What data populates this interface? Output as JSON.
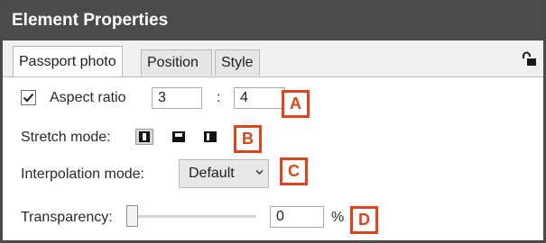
{
  "panel": {
    "title": "Element Properties"
  },
  "tabs": [
    {
      "label": "Passport photo",
      "active": true
    },
    {
      "label": "Position",
      "active": false
    },
    {
      "label": "Style",
      "active": false
    }
  ],
  "aspect_ratio": {
    "label": "Aspect ratio",
    "checked": true,
    "width_value": "3",
    "separator": ":",
    "height_value": "4"
  },
  "stretch_mode": {
    "label": "Stretch mode:",
    "selected_index": 0
  },
  "interpolation_mode": {
    "label": "Interpolation mode:",
    "selected": "Default"
  },
  "transparency": {
    "label": "Transparency:",
    "value": "0",
    "unit": "%",
    "slider_level": 0
  },
  "annotations": {
    "a": "A",
    "b": "B",
    "c": "C",
    "d": "D"
  },
  "colors": {
    "titlebar": "#4b4b4b",
    "annotation": "#e0421a",
    "panel_bg": "#ffffff"
  }
}
